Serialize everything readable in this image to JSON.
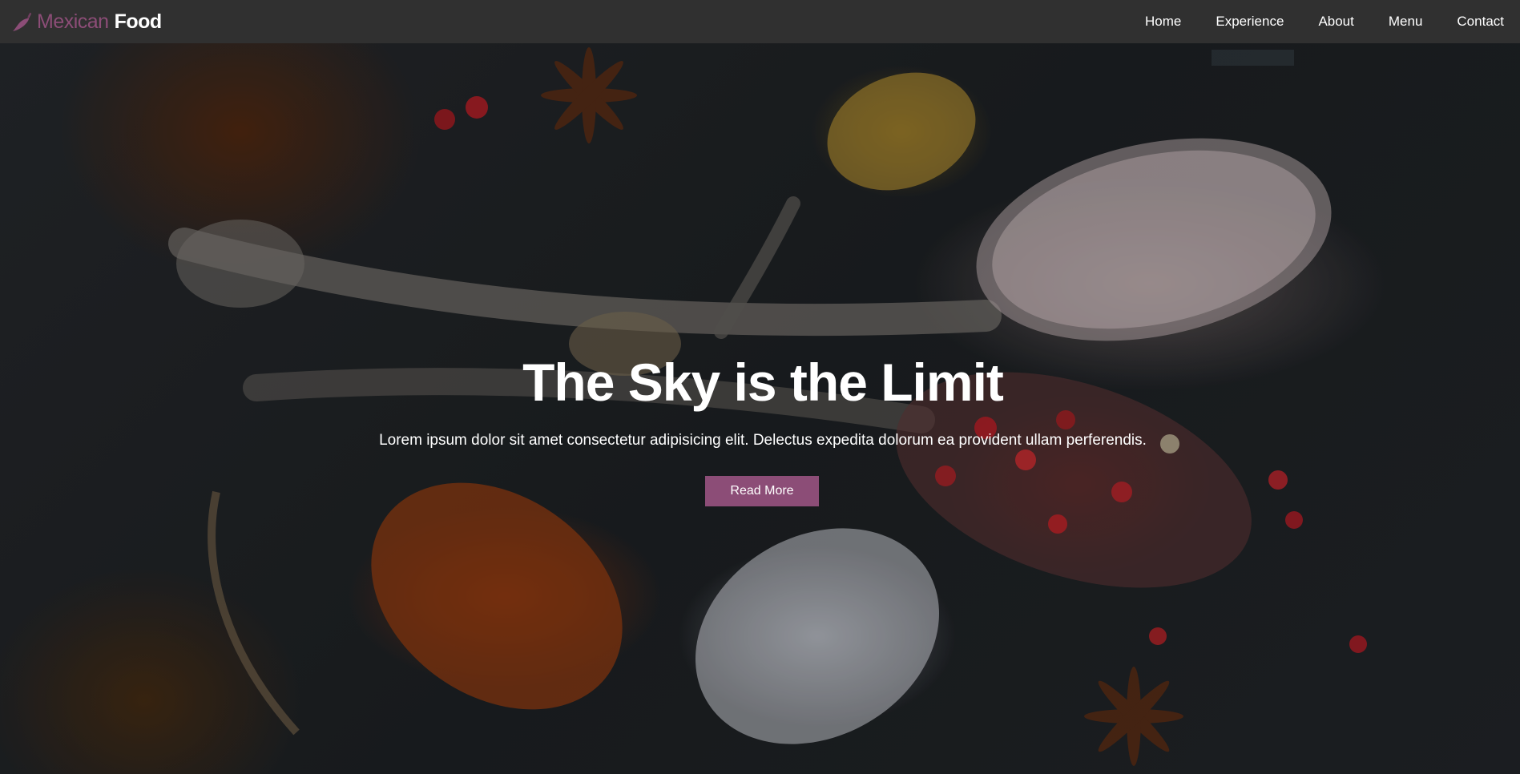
{
  "navbar": {
    "brand": {
      "icon": "chili-pepper-icon",
      "word1": "Mexican",
      "word2": "Food"
    },
    "links": [
      "Home",
      "Experience",
      "About",
      "Menu",
      "Contact"
    ]
  },
  "hero": {
    "title": "The Sky is the Limit",
    "text": "Lorem ipsum dolor sit amet consectetur adipisicing elit. Delectus expedita dolorum ea provident ullam perferendis.",
    "button_label": "Read More",
    "background": "spices-on-spoons-photo"
  },
  "colors": {
    "brand": "#8c4d77",
    "navbar": "#303030",
    "text": "#ffffff"
  }
}
